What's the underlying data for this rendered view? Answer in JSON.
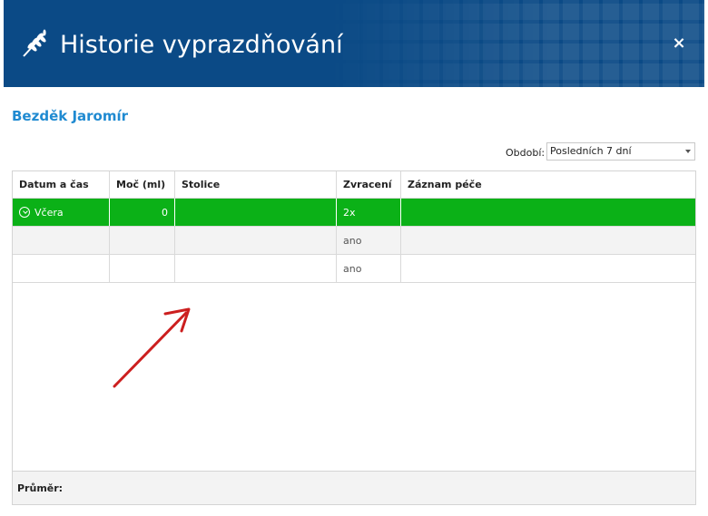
{
  "header": {
    "title": "Historie vyprazdňování",
    "icon": "wheat-icon",
    "close_label": "×"
  },
  "patient_name": "Bezděk Jaromír",
  "period": {
    "label": "Období:",
    "selected": "Posledních 7 dní"
  },
  "table": {
    "columns": [
      "Datum a čas",
      "Moč (ml)",
      "Stolice",
      "Zvracení",
      "Záznam péče"
    ],
    "rows": [
      [
        "Včera",
        "0",
        "",
        "2x",
        ""
      ],
      [
        "",
        "",
        "",
        "ano",
        ""
      ],
      [
        "",
        "",
        "",
        "ano",
        ""
      ]
    ]
  },
  "footer_label": "Průměr:",
  "colors": {
    "header_bg": "#0b4a86",
    "selected_row": "#0bb117",
    "patient_name": "#1f8ad1",
    "annotation_arrow": "#cc1f1f"
  }
}
